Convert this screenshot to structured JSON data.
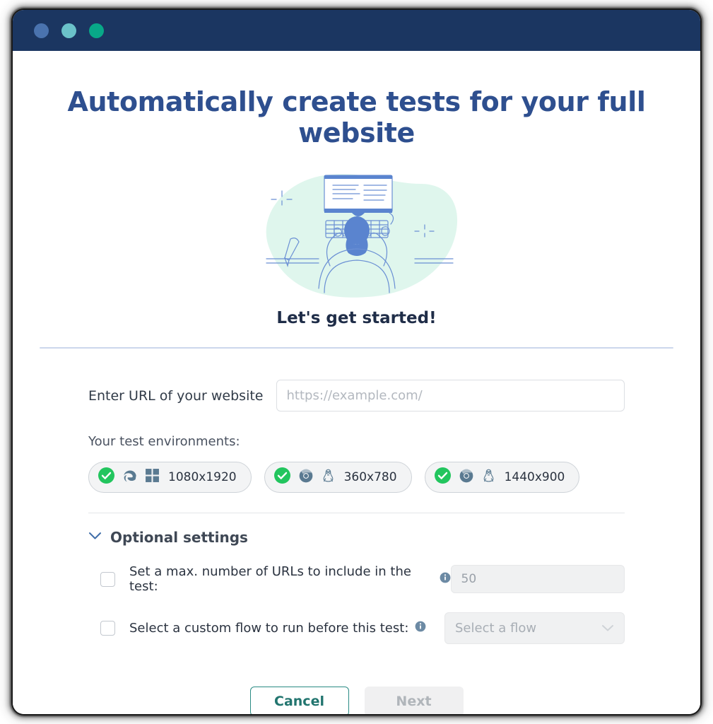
{
  "window": {
    "titlebar_dots": [
      {
        "name": "dot-blue",
        "color": "#4a73ae"
      },
      {
        "name": "dot-teal",
        "color": "#6bc2c9"
      },
      {
        "name": "dot-green",
        "color": "#08a888"
      }
    ]
  },
  "page": {
    "headline": "Automatically create tests for your full website",
    "subhead": "Let's get started!",
    "illustration_name": "person-at-computer-illustration"
  },
  "url_field": {
    "label": "Enter URL of your website",
    "placeholder": "https://example.com/",
    "value": ""
  },
  "environments": {
    "label": "Your test environments:",
    "items": [
      {
        "browser": "edge-icon",
        "os": "windows-icon",
        "resolution": "1080x1920",
        "checked": true
      },
      {
        "browser": "chrome-icon",
        "os": "linux-icon",
        "resolution": "360x780",
        "checked": true
      },
      {
        "browser": "chrome-icon",
        "os": "linux-icon",
        "resolution": "1440x900",
        "checked": true
      }
    ]
  },
  "optional": {
    "title": "Optional settings",
    "expanded": true,
    "rows": [
      {
        "label": "Set a max. number of URLs to include in the test:",
        "checked": false,
        "info_icon": "info-icon",
        "field_type": "number",
        "field_placeholder": "50",
        "field_value": "",
        "field_disabled": true
      },
      {
        "label": "Select a custom flow to run before this test:",
        "checked": false,
        "info_icon": "info-icon",
        "field_type": "select",
        "field_placeholder": "Select a flow",
        "field_value": "Select a flow",
        "field_disabled": true
      }
    ]
  },
  "footer": {
    "cancel_label": "Cancel",
    "next_label": "Next",
    "next_disabled": true
  },
  "colors": {
    "titlebar": "#1b3661",
    "headline": "#2e4f8f",
    "subhead": "#1f2d48",
    "accent_teal": "#2a8b84",
    "check_green": "#22c55e",
    "illustration_blob": "#d9f5ea",
    "illustration_line": "#6a8fd4"
  }
}
